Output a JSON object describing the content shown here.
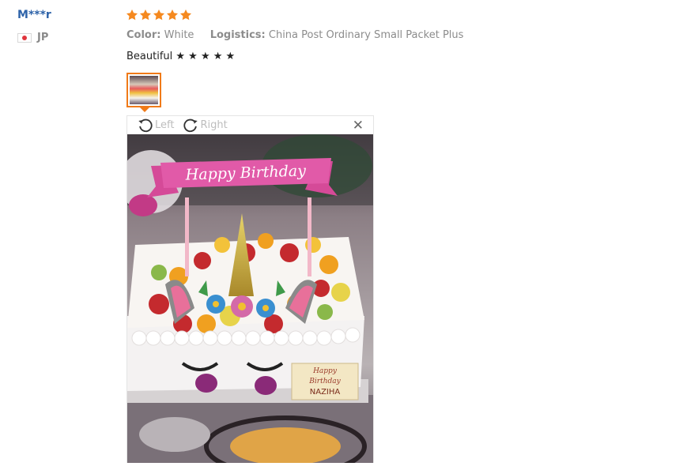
{
  "reviewer": {
    "name": "M***r",
    "country_code": "JP"
  },
  "rating": {
    "stars": 5,
    "color": "#f5891f"
  },
  "attributes": {
    "color_label": "Color:",
    "color_value": "White",
    "logistics_label": "Logistics:",
    "logistics_value": "China Post Ordinary Small Packet Plus"
  },
  "review": {
    "text": "Beautiful ★ ★ ★ ★ ★"
  },
  "viewer": {
    "rotate_left_label": "Left",
    "rotate_right_label": "Right",
    "close_symbol": "✕"
  },
  "photo": {
    "banner_text": "Happy Birthday",
    "plaque_line1": "Happy",
    "plaque_line2": "Birthday",
    "plaque_line3": "NAZIHA"
  },
  "colors": {
    "accent": "#f07a18",
    "link": "#2e63a9"
  }
}
